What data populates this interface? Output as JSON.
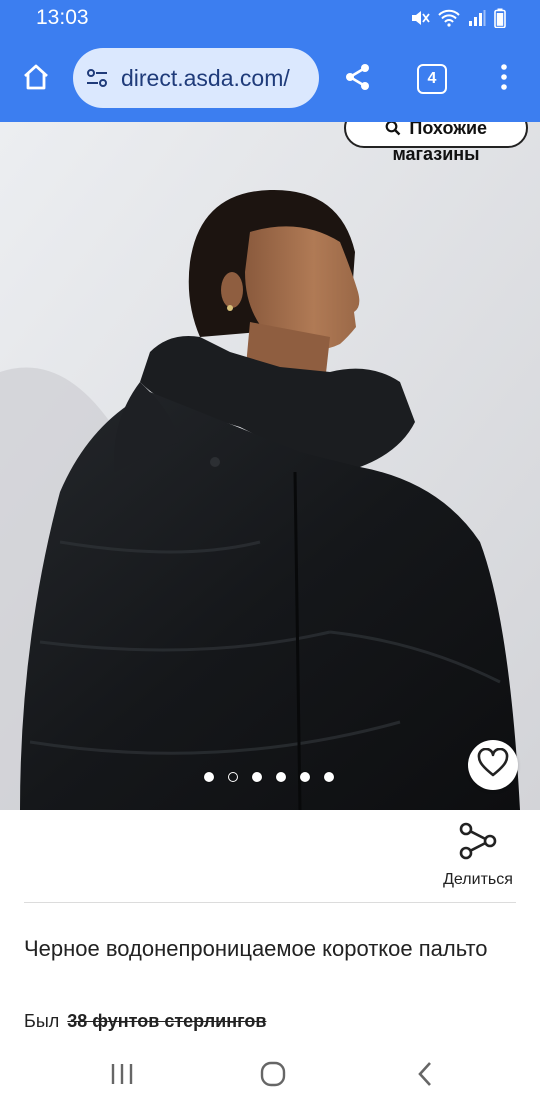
{
  "status_bar": {
    "time": "13:03"
  },
  "browser": {
    "url": "direct.asda.com/",
    "tab_count": "4"
  },
  "product": {
    "similar_button": {
      "line1": "Похожие",
      "line2": "магазины"
    },
    "gallery": {
      "image_count": 6,
      "active_index": 1
    },
    "share_label": "Делиться",
    "title": "Черное водонепроницаемое короткое пальто",
    "price_prefix": "Был",
    "was_price": "38 фунтов стерлингов"
  },
  "colors": {
    "browser_bar": "#3c7ef0",
    "url_pill": "#dbe8fe",
    "text": "#222222"
  }
}
